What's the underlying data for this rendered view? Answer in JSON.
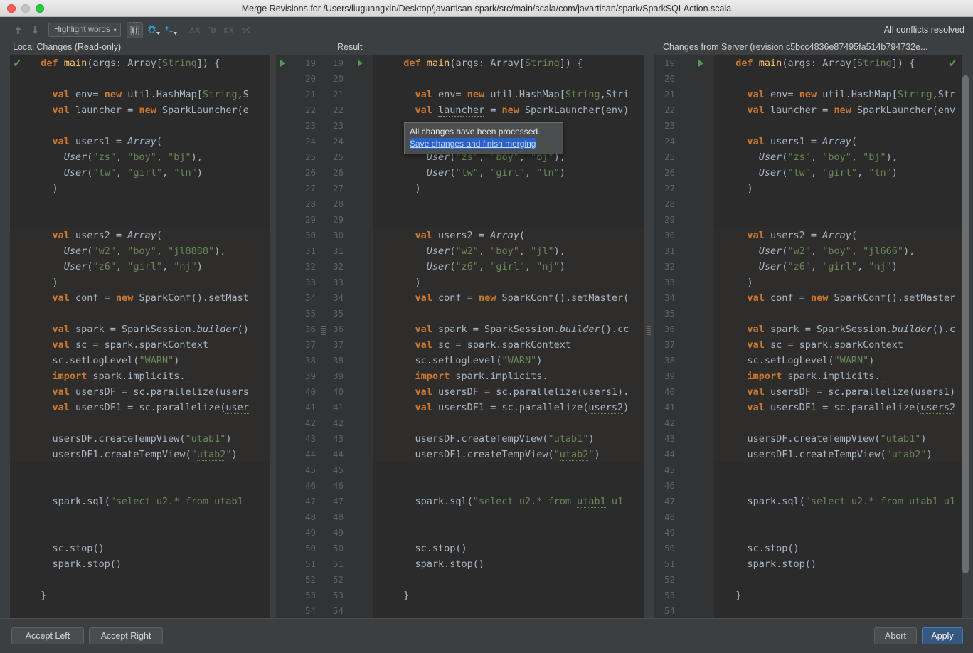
{
  "window": {
    "title": "Merge Revisions for /Users/liuguangxin/Desktop/javartisan-spark/src/main/scala/com/javartisan/spark/SparkSQLAction.scala",
    "traffic": {
      "close": "close-button",
      "minimize": "minimize-button",
      "zoom": "zoom-button"
    }
  },
  "toolbar": {
    "prev_label": "Previous difference",
    "next_label": "Next difference",
    "highlight_mode": "Highlight words",
    "caret": "▾",
    "whitespace_toggle": "Show whitespace",
    "settings_label": "Settings",
    "magic_label": "Apply non-conflicting changes",
    "ignore1_label": "Ignore",
    "ignore2_label": "Ignore right",
    "ignore3_label": "Ignore left",
    "slash_label": "Disable highlighting",
    "status": "All conflicts resolved"
  },
  "panes": {
    "left_title": "Local Changes (Read-only)",
    "mid_title": "Result",
    "right_title": "Changes from Server (revision c5bcc4836e87495fa514b794732e..."
  },
  "popup": {
    "message": "All changes have been processed.",
    "link": "Save changes and finish merging"
  },
  "footer": {
    "accept_left": "Accept Left",
    "accept_right": "Accept Right",
    "abort": "Abort",
    "apply": "Apply"
  },
  "colors": {
    "editor_bg": "#2b2b2b",
    "gutter_bg": "#313335",
    "chrome_bg": "#3c3f41",
    "keyword": "#cc7832",
    "string": "#6a8759",
    "text": "#a9b7c6",
    "method": "#ffc66d",
    "accent_blue": "#365880",
    "marker_green": "#499c54",
    "link_bg": "#2a61c7"
  },
  "gutters": {
    "mid_left_numbers": [
      19,
      20,
      21,
      22,
      23,
      24,
      25,
      26,
      27,
      28,
      29,
      30,
      31,
      32,
      33,
      34,
      35,
      36,
      37,
      38,
      39,
      40,
      41,
      42,
      43,
      44,
      45,
      46,
      47,
      48,
      49,
      50,
      51,
      52,
      53,
      54
    ],
    "mid_right_numbers": [
      19,
      20,
      21,
      22,
      23,
      24,
      25,
      26,
      27,
      28,
      29,
      30,
      31,
      32,
      33,
      34,
      35,
      36,
      37,
      38,
      39,
      40,
      41,
      42,
      43,
      44,
      45,
      46,
      47,
      48,
      49,
      50,
      51,
      52,
      53,
      54
    ],
    "right_numbers": [
      19,
      20,
      21,
      22,
      23,
      24,
      25,
      26,
      27,
      28,
      29,
      30,
      31,
      32,
      33,
      34,
      35,
      36,
      37,
      38,
      39,
      40,
      41,
      42,
      43,
      44,
      45,
      46,
      47,
      48,
      49,
      50,
      51,
      52,
      53,
      54
    ]
  },
  "code": {
    "left": [
      {
        "n": 19,
        "html": "  <span class=\"kw\">def</span> <span class=\"def\">main</span>(args: Array[<span class=\"gen\">String</span>]) {"
      },
      {
        "n": 20,
        "html": ""
      },
      {
        "n": 21,
        "html": "    <span class=\"kw\">val</span> env= <span class=\"kw\">new</span> util.HashMap[<span class=\"gen\">String</span>,S"
      },
      {
        "n": 22,
        "html": "    <span class=\"kw\">val</span> launcher = <span class=\"kw\">new</span> SparkLauncher(e"
      },
      {
        "n": 23,
        "html": ""
      },
      {
        "n": 24,
        "html": "    <span class=\"kw\">val</span> users1 = <span class=\"itl\">Array</span>("
      },
      {
        "n": 25,
        "html": "      <span class=\"itl\">User</span>(<span class=\"str\">\"zs\"</span>, <span class=\"str\">\"boy\"</span>, <span class=\"str\">\"bj\"</span>),"
      },
      {
        "n": 26,
        "html": "      <span class=\"itl\">User</span>(<span class=\"str\">\"lw\"</span>, <span class=\"str\">\"girl\"</span>, <span class=\"str\">\"ln\"</span>)"
      },
      {
        "n": 27,
        "html": "    )"
      },
      {
        "n": 28,
        "html": ""
      },
      {
        "n": 29,
        "html": ""
      },
      {
        "n": 30,
        "html": "    <span class=\"kw\">val</span> users2 = <span class=\"itl\">Array</span>("
      },
      {
        "n": 31,
        "html": "      <span class=\"itl\">User</span>(<span class=\"str\">\"w2\"</span>, <span class=\"str\">\"boy\"</span>, <span class=\"str\">\"jl8888\"</span>),"
      },
      {
        "n": 32,
        "html": "      <span class=\"itl\">User</span>(<span class=\"str\">\"z6\"</span>, <span class=\"str\">\"girl\"</span>, <span class=\"str\">\"nj\"</span>)"
      },
      {
        "n": 33,
        "html": "    )"
      },
      {
        "n": 34,
        "html": "    <span class=\"kw\">val</span> conf = <span class=\"kw\">new</span> SparkConf().setMast"
      },
      {
        "n": 35,
        "html": ""
      },
      {
        "n": 36,
        "html": "    <span class=\"kw\">val</span> spark = SparkSession.<span class=\"itl\">builder</span>()"
      },
      {
        "n": 37,
        "html": "    <span class=\"kw\">val</span> sc = spark.sparkContext"
      },
      {
        "n": 38,
        "html": "    sc.setLogLevel(<span class=\"str\">\"WARN\"</span>)"
      },
      {
        "n": 39,
        "html": "    <span class=\"kw\">import</span> spark.implicits._"
      },
      {
        "n": 40,
        "html": "    <span class=\"kw\">val</span> usersDF = sc.parallelize(<span class=\"und\">users</span>"
      },
      {
        "n": 41,
        "html": "    <span class=\"kw\">val</span> usersDF1 = sc.parallelize(<span class=\"und\">user</span>"
      },
      {
        "n": 42,
        "html": ""
      },
      {
        "n": 43,
        "html": "    usersDF.createTempView(<span class=\"str\">\"<span class=\"und\">utab1</span>\"</span>)"
      },
      {
        "n": 44,
        "html": "    usersDF1.createTempView(<span class=\"str\">\"<span class=\"und\">utab2</span>\"</span>)"
      },
      {
        "n": 45,
        "html": ""
      },
      {
        "n": 46,
        "html": ""
      },
      {
        "n": 47,
        "html": "    spark.sql(<span class=\"str\">\"select u2.* from utab1</span>"
      },
      {
        "n": 48,
        "html": ""
      },
      {
        "n": 49,
        "html": ""
      },
      {
        "n": 50,
        "html": "    sc.stop()"
      },
      {
        "n": 51,
        "html": "    spark.stop()"
      },
      {
        "n": 52,
        "html": ""
      },
      {
        "n": 53,
        "html": "  }"
      },
      {
        "n": 54,
        "html": ""
      }
    ],
    "mid": [
      {
        "n": 19,
        "html": "  <span class=\"kw\">def</span> <span class=\"def\">main</span>(args: Array[<span class=\"gen\">String</span>]) {"
      },
      {
        "n": 20,
        "html": ""
      },
      {
        "n": 21,
        "html": "    <span class=\"kw\">val</span> env= <span class=\"kw\">new</span> util.HashMap[<span class=\"gen\">String</span>,Stri"
      },
      {
        "n": 22,
        "html": "    <span class=\"kw\">val</span> <span class=\"wavy\">launcher</span> = <span class=\"kw\">new</span> SparkLauncher(env)"
      },
      {
        "n": 23,
        "html": ""
      },
      {
        "n": 24,
        "html": "    <span class=\"kw\">val</span> users1 = <span class=\"itl\">Array</span>("
      },
      {
        "n": 25,
        "html": "      <span class=\"itl\">User</span>(<span class=\"str\">\"zs\"</span>, <span class=\"str\">\"boy\"</span>, <span class=\"str\">\"bj\"</span>),"
      },
      {
        "n": 26,
        "html": "      <span class=\"itl\">User</span>(<span class=\"str\">\"lw\"</span>, <span class=\"str\">\"girl\"</span>, <span class=\"str\">\"ln\"</span>)"
      },
      {
        "n": 27,
        "html": "    )"
      },
      {
        "n": 28,
        "html": ""
      },
      {
        "n": 29,
        "html": ""
      },
      {
        "n": 30,
        "html": "    <span class=\"kw\">val</span> users2 = <span class=\"itl\">Array</span>("
      },
      {
        "n": 31,
        "html": "      <span class=\"itl\">User</span>(<span class=\"str\">\"w2\"</span>, <span class=\"str\">\"boy\"</span>, <span class=\"str\">\"jl\"</span>),"
      },
      {
        "n": 32,
        "html": "      <span class=\"itl\">User</span>(<span class=\"str\">\"z6\"</span>, <span class=\"str\">\"girl\"</span>, <span class=\"str\">\"nj\"</span>)"
      },
      {
        "n": 33,
        "html": "    )"
      },
      {
        "n": 34,
        "html": "    <span class=\"kw\">val</span> conf = <span class=\"kw\">new</span> SparkConf().setMaster("
      },
      {
        "n": 35,
        "html": ""
      },
      {
        "n": 36,
        "html": "    <span class=\"kw\">val</span> spark = SparkSession.<span class=\"itl\">builder</span>().cc"
      },
      {
        "n": 37,
        "html": "    <span class=\"kw\">val</span> sc = spark.sparkContext"
      },
      {
        "n": 38,
        "html": "    sc.setLogLevel(<span class=\"str\">\"WARN\"</span>)"
      },
      {
        "n": 39,
        "html": "    <span class=\"kw\">import</span> spark.implicits._"
      },
      {
        "n": 40,
        "html": "    <span class=\"kw\">val</span> usersDF = sc.parallelize(<span class=\"und\">users1</span>)."
      },
      {
        "n": 41,
        "html": "    <span class=\"kw\">val</span> usersDF1 = sc.parallelize(<span class=\"und\">users2</span>)"
      },
      {
        "n": 42,
        "html": ""
      },
      {
        "n": 43,
        "html": "    usersDF.createTempView(<span class=\"str\">\"<span class=\"und\">utab1</span>\"</span>)"
      },
      {
        "n": 44,
        "html": "    usersDF1.createTempView(<span class=\"str\">\"<span class=\"und\">utab2</span>\"</span>)"
      },
      {
        "n": 45,
        "html": ""
      },
      {
        "n": 46,
        "html": ""
      },
      {
        "n": 47,
        "html": "    spark.sql(<span class=\"str\">\"select u2.* from <span class=\"und\">utab1</span> u1</span>"
      },
      {
        "n": 48,
        "html": ""
      },
      {
        "n": 49,
        "html": ""
      },
      {
        "n": 50,
        "html": "    sc.stop()"
      },
      {
        "n": 51,
        "html": "    spark.stop()"
      },
      {
        "n": 52,
        "html": ""
      },
      {
        "n": 53,
        "html": "  }"
      },
      {
        "n": 54,
        "html": ""
      }
    ],
    "right": [
      {
        "n": 19,
        "html": "  <span class=\"kw\">def</span> <span class=\"def\">main</span>(args: Array[<span class=\"gen\">String</span>]) {"
      },
      {
        "n": 20,
        "html": ""
      },
      {
        "n": 21,
        "html": "    <span class=\"kw\">val</span> env= <span class=\"kw\">new</span> util.HashMap[<span class=\"gen\">String</span>,Str"
      },
      {
        "n": 22,
        "html": "    <span class=\"kw\">val</span> launcher = <span class=\"kw\">new</span> SparkLauncher(env"
      },
      {
        "n": 23,
        "html": ""
      },
      {
        "n": 24,
        "html": "    <span class=\"kw\">val</span> users1 = <span class=\"itl\">Array</span>("
      },
      {
        "n": 25,
        "html": "      <span class=\"itl\">User</span>(<span class=\"str\">\"zs\"</span>, <span class=\"str\">\"boy\"</span>, <span class=\"str\">\"bj\"</span>),"
      },
      {
        "n": 26,
        "html": "      <span class=\"itl\">User</span>(<span class=\"str\">\"lw\"</span>, <span class=\"str\">\"girl\"</span>, <span class=\"str\">\"ln\"</span>)"
      },
      {
        "n": 27,
        "html": "    )"
      },
      {
        "n": 28,
        "html": ""
      },
      {
        "n": 29,
        "html": ""
      },
      {
        "n": 30,
        "html": "    <span class=\"kw\">val</span> users2 = <span class=\"itl\">Array</span>("
      },
      {
        "n": 31,
        "html": "      <span class=\"itl\">User</span>(<span class=\"str\">\"w2\"</span>, <span class=\"str\">\"boy\"</span>, <span class=\"str\">\"jl666\"</span>),"
      },
      {
        "n": 32,
        "html": "      <span class=\"itl\">User</span>(<span class=\"str\">\"z6\"</span>, <span class=\"str\">\"girl\"</span>, <span class=\"str\">\"nj\"</span>)"
      },
      {
        "n": 33,
        "html": "    )"
      },
      {
        "n": 34,
        "html": "    <span class=\"kw\">val</span> conf = <span class=\"kw\">new</span> SparkConf().setMaster"
      },
      {
        "n": 35,
        "html": ""
      },
      {
        "n": 36,
        "html": "    <span class=\"kw\">val</span> spark = SparkSession.<span class=\"itl\">builder</span>().c"
      },
      {
        "n": 37,
        "html": "    <span class=\"kw\">val</span> sc = spark.sparkContext"
      },
      {
        "n": 38,
        "html": "    sc.setLogLevel(<span class=\"str\">\"WARN\"</span>)"
      },
      {
        "n": 39,
        "html": "    <span class=\"kw\">import</span> spark.implicits._"
      },
      {
        "n": 40,
        "html": "    <span class=\"kw\">val</span> usersDF = sc.parallelize(<span class=\"und\">users1</span>)"
      },
      {
        "n": 41,
        "html": "    <span class=\"kw\">val</span> usersDF1 = sc.parallelize(<span class=\"und\">users2</span>"
      },
      {
        "n": 42,
        "html": ""
      },
      {
        "n": 43,
        "html": "    usersDF.createTempView(<span class=\"str\">\"utab1\"</span>)"
      },
      {
        "n": 44,
        "html": "    usersDF1.createTempView(<span class=\"str\">\"utab2\"</span>)"
      },
      {
        "n": 45,
        "html": ""
      },
      {
        "n": 46,
        "html": ""
      },
      {
        "n": 47,
        "html": "    spark.sql(<span class=\"str\">\"select u2.* from utab1 u1</span>"
      },
      {
        "n": 48,
        "html": ""
      },
      {
        "n": 49,
        "html": ""
      },
      {
        "n": 50,
        "html": "    sc.stop()"
      },
      {
        "n": 51,
        "html": "    spark.stop()"
      },
      {
        "n": 52,
        "html": ""
      },
      {
        "n": 53,
        "html": "  }"
      },
      {
        "n": 54,
        "html": ""
      }
    ]
  }
}
